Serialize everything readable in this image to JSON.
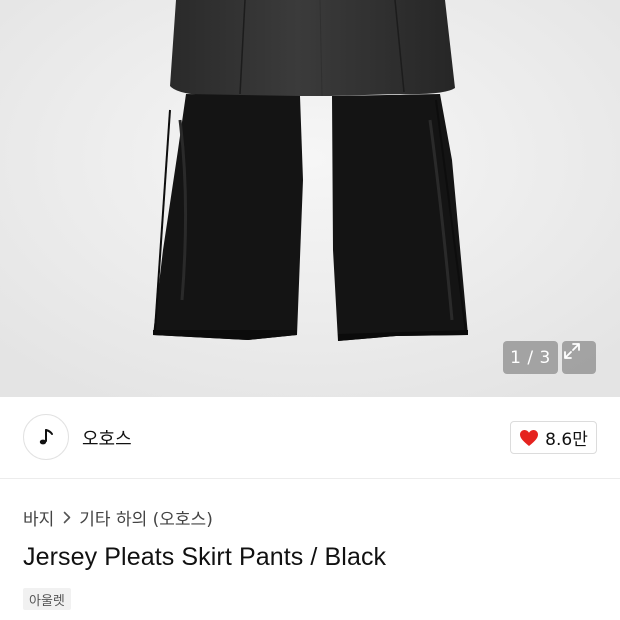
{
  "gallery": {
    "current": "1",
    "separator": "/",
    "total": "3",
    "counter_text": "1 / 3",
    "expand_icon": "expand-arrows-icon"
  },
  "brand": {
    "name": "오호스",
    "logo_icon": "music-note-logo-icon"
  },
  "like": {
    "icon": "heart-icon",
    "count": "8.6만",
    "color": "#e5231f"
  },
  "breadcrumb": {
    "items": [
      "바지",
      "기타 하의 (오호스)"
    ],
    "separator_icon": "chevron-right-icon"
  },
  "product": {
    "title": "Jersey Pleats Skirt Pants / Black",
    "tag": "아울렛"
  }
}
